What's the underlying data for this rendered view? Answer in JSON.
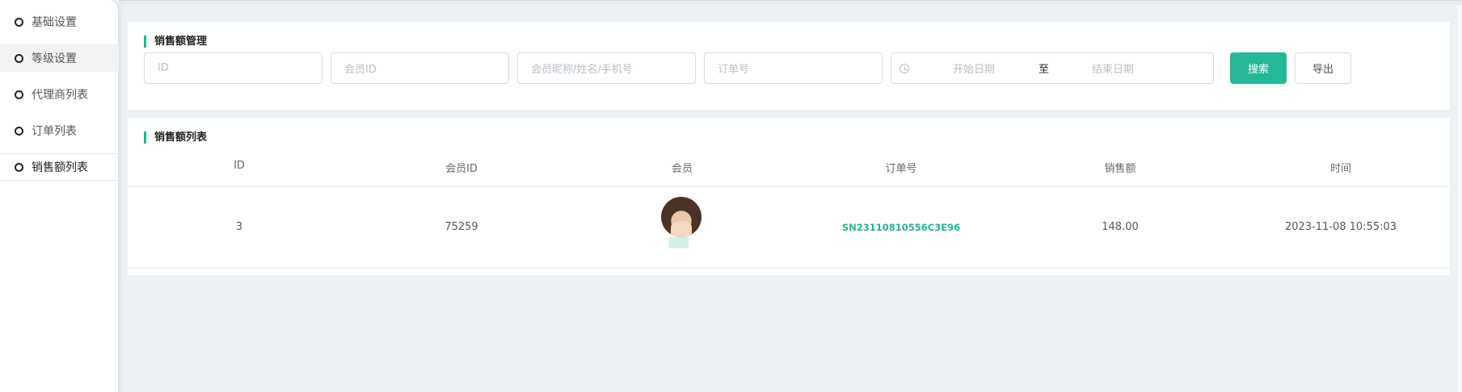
{
  "sidebar": {
    "items": [
      {
        "label": "基础设置"
      },
      {
        "label": "等级设置"
      },
      {
        "label": "代理商列表"
      },
      {
        "label": "订单列表"
      },
      {
        "label": "销售额列表"
      }
    ]
  },
  "search_card": {
    "title": "销售额管理",
    "fields": {
      "id_placeholder": "ID",
      "member_id_placeholder": "会员ID",
      "member_info_placeholder": "会员昵称/姓名/手机号",
      "order_no_placeholder": "订单号"
    },
    "date_range": {
      "start_placeholder": "开始日期",
      "separator": "至",
      "end_placeholder": "结束日期"
    },
    "buttons": {
      "search_label": "搜索",
      "export_label": "导出"
    }
  },
  "table_card": {
    "title": "销售额列表",
    "columns": [
      "ID",
      "会员ID",
      "会员",
      "订单号",
      "销售额",
      "时间"
    ],
    "rows": [
      {
        "id": "3",
        "member_id": "75259",
        "order_no": "SN23110810556C3E96",
        "amount": "148.00",
        "time": "2023-11-08 10:55:03"
      }
    ]
  },
  "colors": {
    "accent": "#26b896",
    "background": "#eef1f4"
  },
  "icons": {
    "sidebar_item": "circle-outline-icon",
    "date": "clock-icon"
  }
}
